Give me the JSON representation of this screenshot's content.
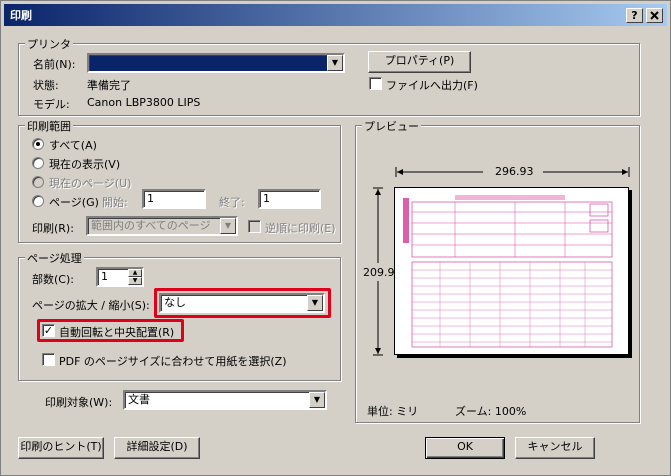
{
  "window": {
    "title": "印刷",
    "help_button": "?",
    "close_button": "X"
  },
  "printer": {
    "legend": "プリンタ",
    "name_label": "名前(N):",
    "name_value": "",
    "properties_button": "プロパティ(P)",
    "status_label": "状態:",
    "status_value": "準備完了",
    "model_label": "モデル:",
    "model_value": "Canon LBP3800 LIPS",
    "print_to_file_label": "ファイルへ出力(F)",
    "print_to_file_checked": false
  },
  "range": {
    "legend": "印刷範囲",
    "all_label": "すべて(A)",
    "current_view_label": "現在の表示(V)",
    "current_page_label": "現在のページ(U)",
    "pages_label": "ページ(G)",
    "start_label": "開始:",
    "start_value": "1",
    "end_label": "終了:",
    "end_value": "1",
    "print_label": "印刷(R):",
    "print_value": "範囲内のすべてのページ",
    "reverse_label": "逆順に印刷(E)",
    "selected": "all"
  },
  "page_handling": {
    "legend": "ページ処理",
    "copies_label": "部数(C):",
    "copies_value": "1",
    "scaling_label": "ページの拡大 / 縮小(S):",
    "scaling_value": "なし",
    "auto_rotate_label": "自動回転と中央配置(R)",
    "auto_rotate_checked": true,
    "pdf_size_label": "PDF のページサイズに合わせて用紙を選択(Z)",
    "pdf_size_checked": false
  },
  "print_what": {
    "label": "印刷対象(W):",
    "value": "文書"
  },
  "preview": {
    "legend": "プレビュー",
    "width_value": "296.93",
    "height_value": "209.9",
    "units_label": "単位: ミリ",
    "zoom_label": "ズーム: 100%"
  },
  "footer": {
    "hint_button": "印刷のヒント(T)",
    "advanced_button": "詳細設定(D)",
    "ok_button": "OK",
    "cancel_button": "キャンセル"
  },
  "colors": {
    "highlight": "#e0001a",
    "title_bar": "#0a246a",
    "selection": "#0a246a",
    "form_pink": "#d8439a"
  }
}
